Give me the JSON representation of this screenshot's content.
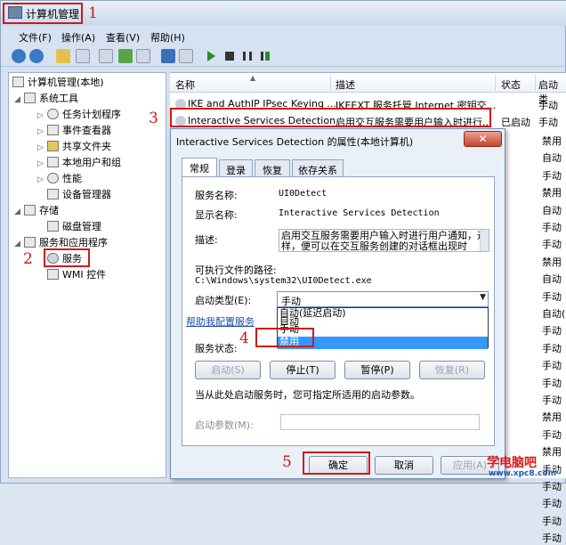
{
  "window": {
    "title": "计算机管理"
  },
  "steps": [
    "1",
    "2",
    "3",
    "4",
    "5"
  ],
  "menu": [
    "文件(F)",
    "操作(A)",
    "查看(V)",
    "帮助(H)"
  ],
  "tree": [
    {
      "label": "计算机管理(本地)",
      "level": 0,
      "icon": "computer-icon"
    },
    {
      "label": "系统工具",
      "level": 1,
      "icon": "tools-icon"
    },
    {
      "label": "任务计划程序",
      "level": 2,
      "icon": "clock-icon"
    },
    {
      "label": "事件查看器",
      "level": 2,
      "icon": "event-icon"
    },
    {
      "label": "共享文件夹",
      "level": 2,
      "icon": "folder-icon"
    },
    {
      "label": "本地用户和组",
      "level": 2,
      "icon": "users-icon"
    },
    {
      "label": "性能",
      "level": 2,
      "icon": "performance-icon"
    },
    {
      "label": "设备管理器",
      "level": 2,
      "icon": "device-icon"
    },
    {
      "label": "存储",
      "level": 1,
      "icon": "storage-icon"
    },
    {
      "label": "磁盘管理",
      "level": 2,
      "icon": "disk-icon"
    },
    {
      "label": "服务和应用程序",
      "level": 1,
      "icon": "apps-icon"
    },
    {
      "label": "服务",
      "level": 2,
      "icon": "gear-icon"
    },
    {
      "label": "WMI 控件",
      "level": 2,
      "icon": "wmi-icon"
    }
  ],
  "list": {
    "columns": [
      "名称",
      "描述",
      "状态",
      "启动类"
    ],
    "rows": [
      {
        "name": "IKE and AuthIP IPsec Keying ...",
        "desc": "IKEEXT 服务托管 Internet 密钥交...",
        "status": "",
        "start": "手动"
      },
      {
        "name": "Interactive Services Detection",
        "desc": "启用交互服务需要用户输入时进行...",
        "status": "已启动",
        "start": "手动"
      }
    ],
    "start_types_right": [
      "禁用",
      "自动",
      "手动",
      "禁用",
      "自动",
      "手动",
      "手动",
      "禁用",
      "自动",
      "手动",
      "自动(",
      "手动",
      "手动",
      "手动",
      "手动",
      "手动",
      "禁用",
      "手动",
      "禁用",
      "手动",
      "手动",
      "手动",
      "手动",
      "手动"
    ]
  },
  "dialog": {
    "title": "Interactive Services Detection 的属性(本地计算机)",
    "close": "✕",
    "tabs": [
      "常规",
      "登录",
      "恢复",
      "依存关系"
    ],
    "service_name_label": "服务名称:",
    "service_name": "UI0Detect",
    "display_name_label": "显示名称:",
    "display_name": "Interactive Services Detection",
    "description_label": "描述:",
    "description": "启用交互服务需要用户输入时进行用户通知，这样，便可以在交互服务创建的对话框出现时",
    "path_label": "可执行文件的路径:",
    "path": "C:\\Windows\\system32\\UI0Detect.exe",
    "startup_label": "启动类型(E):",
    "startup_value": "手动",
    "startup_options": [
      "自动(延迟启动)",
      "自动",
      "手动",
      "禁用"
    ],
    "help_link": "帮助我配置服务",
    "status_label": "服务状态:",
    "buttons": [
      "启动(S)",
      "停止(T)",
      "暂停(P)",
      "恢复(R)"
    ],
    "hint": "当从此处启动服务时，您可指定所适用的启动参数。",
    "param_label": "启动参数(M):",
    "ok": "确定",
    "cancel": "取消",
    "apply": "应用(A)"
  },
  "watermark": {
    "top": "学电脑吧",
    "bottom": "www.xpc8.com"
  },
  "colors": {
    "highlight": "#d01818",
    "selection": "#3399ff",
    "link": "#1d4fa8"
  }
}
